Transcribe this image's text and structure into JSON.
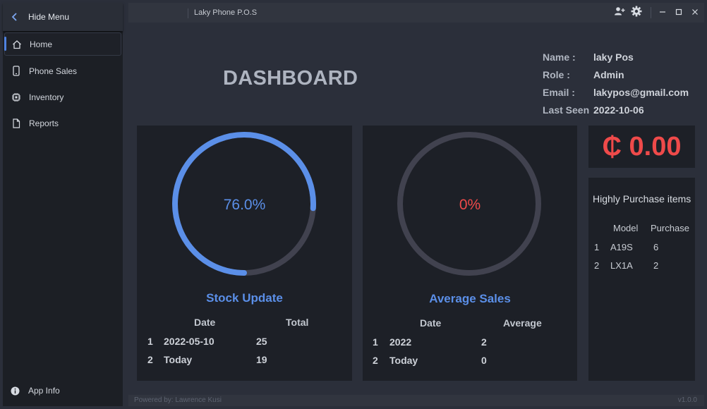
{
  "sidebar": {
    "hide_menu": "Hide Menu",
    "items": [
      {
        "label": "Home",
        "icon": "home-icon",
        "active": true
      },
      {
        "label": "Phone Sales",
        "icon": "phone-icon",
        "active": false
      },
      {
        "label": "Inventory",
        "icon": "chip-icon",
        "active": false
      },
      {
        "label": "Reports",
        "icon": "document-icon",
        "active": false
      }
    ],
    "app_info": "App Info"
  },
  "titlebar": {
    "title": "Laky Phone P.O.S"
  },
  "dashboard": {
    "title": "DASHBOARD"
  },
  "profile": {
    "name_label": "Name :",
    "name": "laky Pos",
    "role_label": "Role :",
    "role": "Admin",
    "email_label": "Email :",
    "email": "lakypos@gmail.com",
    "last_seen_label": "Last Seen",
    "last_seen": "2022-10-06"
  },
  "stock": {
    "percent_text": "76.0%",
    "progress": 0.76,
    "title": "Stock Update",
    "headers": [
      "Date",
      "Total"
    ],
    "rows": [
      {
        "num": "1",
        "date": "2022-05-10",
        "value": "25"
      },
      {
        "num": "2",
        "date": "Today",
        "value": "19"
      }
    ]
  },
  "average": {
    "percent_text": "0%",
    "progress": 0,
    "title": "Average Sales",
    "headers": [
      "Date",
      "Average"
    ],
    "rows": [
      {
        "num": "1",
        "date": "2022",
        "value": "2"
      },
      {
        "num": "2",
        "date": "Today",
        "value": "0"
      }
    ]
  },
  "amount": "₵ 0.00",
  "items": {
    "title": "Highly Purchase items",
    "headers": [
      "Model",
      "Purchase"
    ],
    "rows": [
      {
        "num": "1",
        "model": "A19S",
        "purchase": "6"
      },
      {
        "num": "2",
        "model": "LX1A",
        "purchase": "2"
      }
    ]
  },
  "footer": {
    "powered": "Powered by: Lawrence Kusi",
    "version": "v1.0.0"
  },
  "colors": {
    "accent": "#5b8fe8",
    "ring_track": "#41424f",
    "danger": "#ef4a4a"
  }
}
